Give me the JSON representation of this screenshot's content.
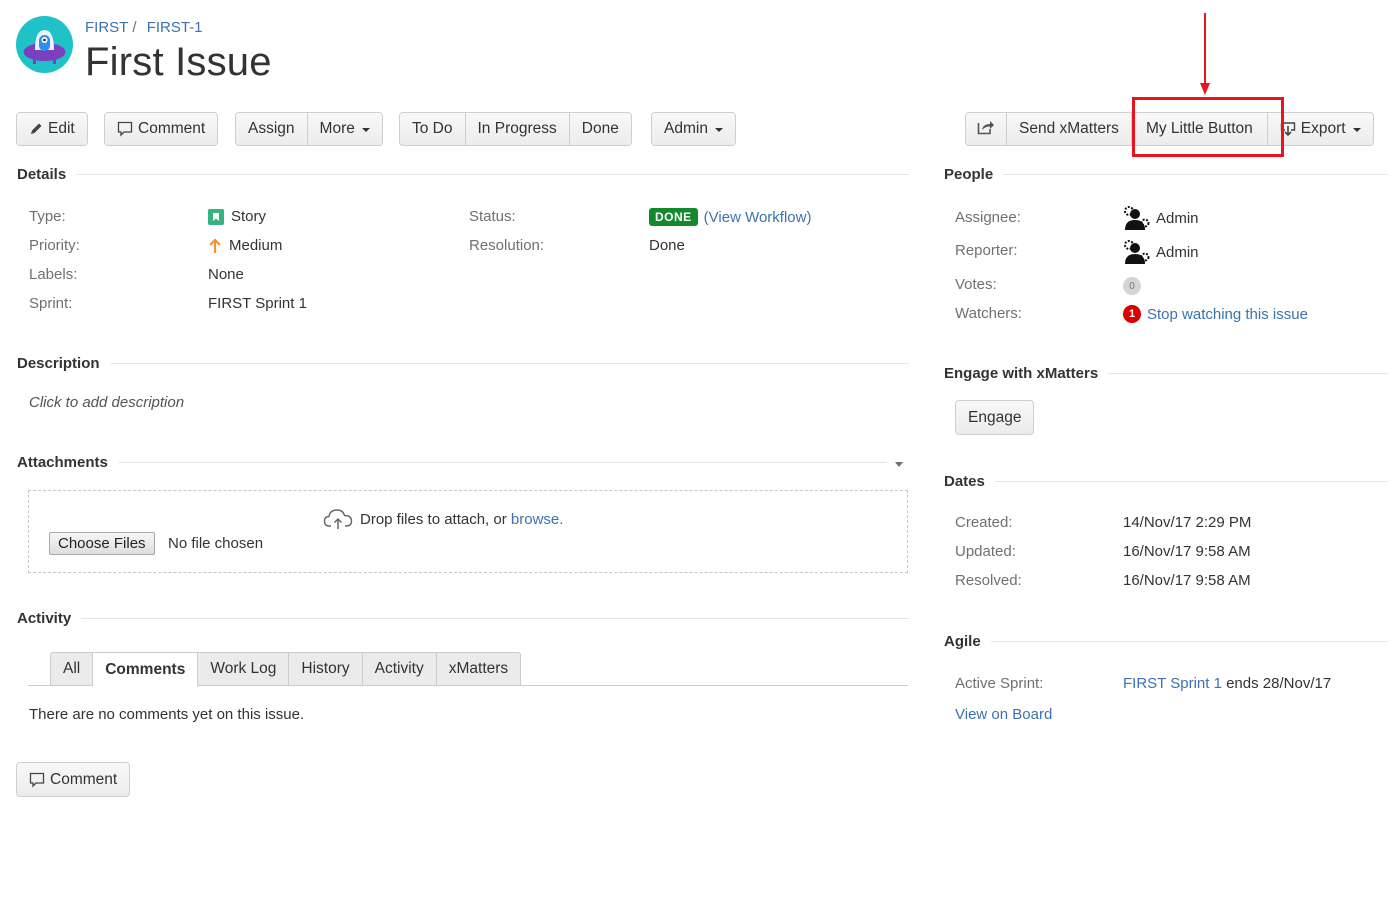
{
  "header": {
    "breadcrumbs": [
      "FIRST",
      "FIRST-1"
    ],
    "breadcrumb_separator": "/",
    "title": "First Issue"
  },
  "toolbar": {
    "edit": "Edit",
    "comment": "Comment",
    "assign": "Assign",
    "more": "More",
    "todo": "To Do",
    "in_progress": "In Progress",
    "done": "Done",
    "admin": "Admin",
    "send_xmatters": "Send xMatters",
    "my_little_button": "My Little Button",
    "export": "Export"
  },
  "annotation": {
    "highlight_color": "#e8141e",
    "target": "My Little Button"
  },
  "details": {
    "heading": "Details",
    "left": [
      {
        "label": "Type:",
        "value": "Story",
        "icon": "story-icon"
      },
      {
        "label": "Priority:",
        "value": "Medium",
        "icon": "priority-medium-arrow-icon"
      },
      {
        "label": "Labels:",
        "value": "None"
      },
      {
        "label": "Sprint:",
        "value": "FIRST Sprint 1"
      }
    ],
    "right": [
      {
        "label": "Status:",
        "value": "DONE",
        "link": "(View Workflow)"
      },
      {
        "label": "Resolution:",
        "value": "Done"
      }
    ]
  },
  "description": {
    "heading": "Description",
    "placeholder": "Click to add description"
  },
  "attachments": {
    "heading": "Attachments",
    "drop_text": "Drop files to attach, or",
    "browse_link": "browse.",
    "choose_files": "Choose Files",
    "no_file": "No file chosen"
  },
  "activity": {
    "heading": "Activity",
    "tabs": [
      {
        "label": "All",
        "active": false
      },
      {
        "label": "Comments",
        "active": true
      },
      {
        "label": "Work Log",
        "active": false
      },
      {
        "label": "History",
        "active": false
      },
      {
        "label": "Activity",
        "active": false
      },
      {
        "label": "xMatters",
        "active": false
      }
    ],
    "empty_text": "There are no comments yet on this issue.",
    "comment_button": "Comment"
  },
  "people": {
    "heading": "People",
    "assignee_label": "Assignee:",
    "assignee": "Admin",
    "reporter_label": "Reporter:",
    "reporter": "Admin",
    "votes_label": "Votes:",
    "votes": "0",
    "watchers_label": "Watchers:",
    "watchers": "1",
    "watch_link": "Stop watching this issue"
  },
  "xmatters": {
    "heading": "Engage with xMatters",
    "engage_button": "Engage"
  },
  "dates": {
    "heading": "Dates",
    "created_label": "Created:",
    "created": "14/Nov/17 2:29 PM",
    "updated_label": "Updated:",
    "updated": "16/Nov/17 9:58 AM",
    "resolved_label": "Resolved:",
    "resolved": "16/Nov/17 9:58 AM"
  },
  "agile": {
    "heading": "Agile",
    "active_sprint_label": "Active Sprint:",
    "sprint_link": "FIRST Sprint 1",
    "sprint_end": "ends 28/Nov/17",
    "view_board": "View on Board"
  },
  "colors": {
    "link": "#3b73af",
    "status_done": "#14892c",
    "story": "#36b37e",
    "priority_medium": "#f79232",
    "watch_badge": "#dd0000"
  }
}
